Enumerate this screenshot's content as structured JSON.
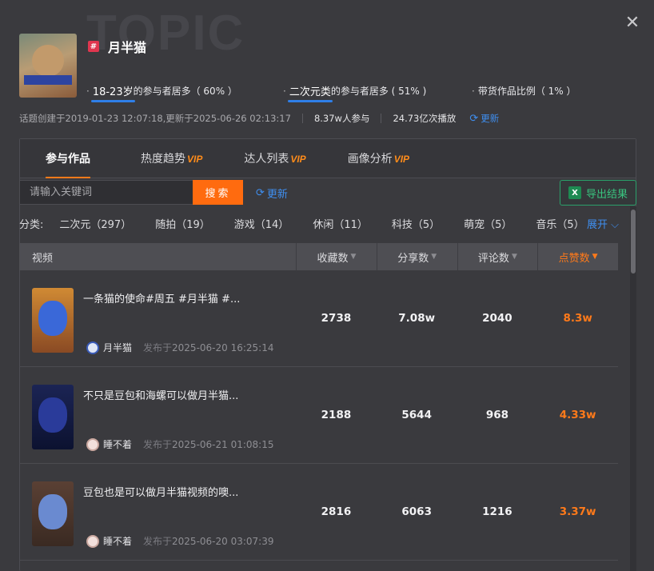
{
  "watermark": "TOPIC",
  "topic": {
    "title": "月半猫",
    "hash": "#"
  },
  "stats": [
    {
      "highlight": "18-23岁",
      "text": "的参与者居多（ 60% ）"
    },
    {
      "highlight": "二次元类",
      "text": "的参与者居多 ( 51% )"
    },
    {
      "highlight": "",
      "text": "带货作品比例（ 1% ）"
    }
  ],
  "meta": {
    "created": "话题创建于2019-01-23 12:07:18,更新于2025-06-26 02:13:17",
    "participants": "8.37w人参与",
    "plays": "24.73亿次播放",
    "refresh": "更新"
  },
  "tabs": [
    {
      "label": "参与作品",
      "vip": ""
    },
    {
      "label": "热度趋势",
      "vip": "VIP"
    },
    {
      "label": "达人列表",
      "vip": "VIP"
    },
    {
      "label": "画像分析",
      "vip": "VIP"
    }
  ],
  "search": {
    "placeholder": "请输入关键词",
    "button": "搜索",
    "refresh": "更新",
    "export": "导出结果"
  },
  "categories": {
    "label": "分类:",
    "items": [
      "二次元（297）",
      "随拍（19）",
      "游戏（14）",
      "休闲（11）",
      "科技（5）",
      "萌宠（5）",
      "音乐（5）"
    ],
    "expand": "展开"
  },
  "table": {
    "headers": {
      "video": "视频",
      "favorites": "收藏数",
      "shares": "分享数",
      "comments": "评论数",
      "likes": "点赞数"
    },
    "rows": [
      {
        "title": "一条猫的使命#周五 #月半猫 #...",
        "author": "月半猫",
        "pub_label": "发布于",
        "pub_time": "2025-06-20 16:25:14",
        "favorites": "2738",
        "shares": "7.08w",
        "comments": "2040",
        "likes": "8.3w"
      },
      {
        "title": "不只是豆包和海螺可以做月半猫...",
        "author": "睡不着",
        "pub_label": "发布于",
        "pub_time": "2025-06-21 01:08:15",
        "favorites": "2188",
        "shares": "5644",
        "comments": "968",
        "likes": "4.33w"
      },
      {
        "title": "豆包也是可以做月半猫视频的噢...",
        "author": "睡不着",
        "pub_label": "发布于",
        "pub_time": "2025-06-20 03:07:39",
        "favorites": "2816",
        "shares": "6063",
        "comments": "1216",
        "likes": "3.37w"
      }
    ]
  },
  "colors": {
    "accent": "#ff7a1a",
    "link": "#3f8ff0",
    "export": "#39c47f"
  }
}
